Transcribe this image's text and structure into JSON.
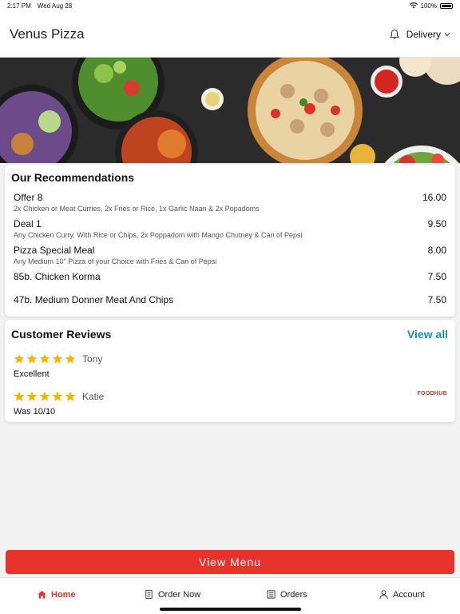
{
  "status_bar": {
    "time": "2:17 PM",
    "date": "Wed Aug 28",
    "battery": "100%"
  },
  "header": {
    "title": "Venus Pizza",
    "mode_label": "Delivery"
  },
  "recommendations": {
    "title": "Our Recommendations",
    "items": [
      {
        "name": "Offer 8",
        "description": "2x Chicken or Meat Curries, 2x Fries or Rice, 1x Garlic Naan & 2x Popadoms",
        "price": "16.00"
      },
      {
        "name": "Deal 1",
        "description": "Any Chicken Curry, With Rice or Chips, 2x Poppadom with Mango Chutney & Can of Pepsi",
        "price": "9.50"
      },
      {
        "name": "Pizza Special Meal",
        "description": "Any Medium 10\" Pizza of your Choice with Fries & Can of Pepsi",
        "price": "8.00"
      },
      {
        "name": "85b. Chicken Korma",
        "description": "",
        "price": "7.50"
      },
      {
        "name": "47b. Medium Donner Meat And Chips",
        "description": "",
        "price": "7.50"
      }
    ]
  },
  "reviews": {
    "title": "Customer Reviews",
    "view_all_label": "View all",
    "items": [
      {
        "name": "Tony",
        "rating": 5,
        "text": "Excellent"
      },
      {
        "name": "Katie",
        "rating": 5,
        "text": "Was 10/10"
      }
    ],
    "brand": "FOODHUB"
  },
  "view_menu_label": "View Menu",
  "tabs": [
    {
      "label": "Home",
      "icon": "home-icon",
      "active": true
    },
    {
      "label": "Order Now",
      "icon": "order-icon",
      "active": false
    },
    {
      "label": "Orders",
      "icon": "orders-list-icon",
      "active": false
    },
    {
      "label": "Account",
      "icon": "user-icon",
      "active": false
    }
  ],
  "colors": {
    "accent": "#e8322b",
    "link": "#1a8fb3",
    "star": "#f5b400"
  }
}
